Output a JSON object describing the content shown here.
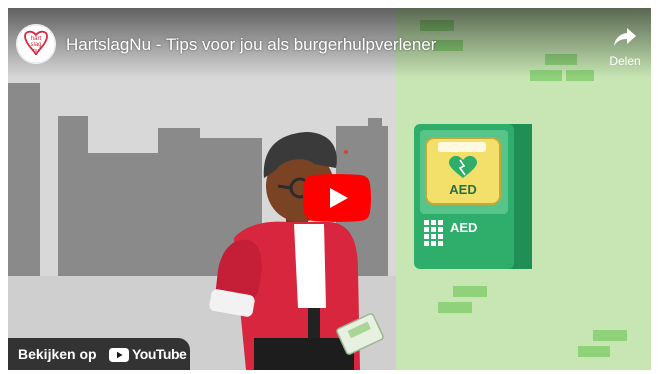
{
  "player": {
    "title": "HartslagNu - Tips voor jou als burgerhulpverlener",
    "share_label": "Delen",
    "watch_on_label": "Bekijken op",
    "youtube_wordmark": "YouTube",
    "channel_logo_text": [
      "hart",
      "slag",
      "nu"
    ]
  },
  "scene": {
    "aed_label": "AED",
    "aed_cabinet_label": "AED"
  },
  "colors": {
    "city_background": "#d8d8d8",
    "building": "#8a8a8a",
    "wall_green": "#c7e6b4",
    "brick_green": "#8fd27a",
    "cabinet_green": "#2eae6a",
    "play_red": "#ff0000",
    "shirt_red": "#d7263d"
  },
  "icons": [
    "share-icon",
    "play-icon",
    "youtube-logo-icon",
    "aed-heart-icon",
    "keypad-icon"
  ]
}
